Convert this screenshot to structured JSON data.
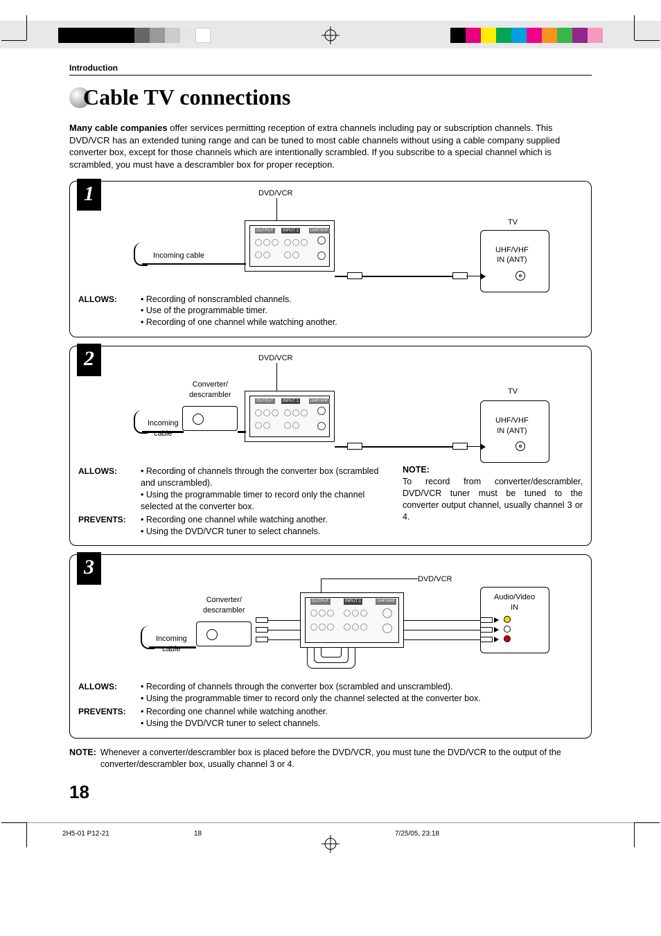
{
  "header": {
    "section_label": "Introduction"
  },
  "title": "Cable TV connections",
  "intro": {
    "bold": "Many cable companies",
    "rest": " offer services permitting reception of extra channels including pay or subscription channels. This DVD/VCR has an extended tuning range and can be tuned to most cable channels without using a cable company supplied converter box, except for those channels which are intentionally scrambled. If you subscribe to a special channel which is scrambled, you must have a descrambler box for proper reception."
  },
  "diagrams": [
    {
      "num": "1",
      "labels": {
        "dvdvcr": "DVD/VCR",
        "tv": "TV",
        "tv_port": "UHF/VHF\nIN (ANT)",
        "incoming": "Incoming cable"
      },
      "allows_label": "ALLOWS:",
      "allows": [
        "Recording of nonscrambled channels.",
        "Use of the programmable timer.",
        "Recording of one channel while watching another."
      ]
    },
    {
      "num": "2",
      "labels": {
        "dvdvcr": "DVD/VCR",
        "tv": "TV",
        "tv_port": "UHF/VHF\nIN (ANT)",
        "incoming": "Incoming\ncable",
        "converter": "Converter/\ndescrambler"
      },
      "allows_label": "ALLOWS:",
      "allows": [
        "Recording of channels through the converter box (scrambled and unscrambled).",
        "Using the programmable timer to record only the channel selected at the converter box."
      ],
      "prevents_label": "PREVENTS:",
      "prevents": [
        "Recording one channel while watching another.",
        "Using the DVD/VCR tuner to select channels."
      ],
      "note_label": "NOTE:",
      "note_text": "To record from converter/descrambler, DVD/VCR tuner must be tuned to the converter output channel, usually channel 3 or 4."
    },
    {
      "num": "3",
      "labels": {
        "dvdvcr": "DVD/VCR",
        "av_in": "Audio/Video\nIN",
        "incoming": "Incoming\ncable",
        "converter": "Converter/\ndescrambler"
      },
      "allows_label": "ALLOWS:",
      "allows": [
        "Recording of channels through the converter box (scrambled and unscrambled).",
        "Using the programmable timer to record only the channel selected at the converter box."
      ],
      "prevents_label": "PREVENTS:",
      "prevents": [
        "Recording one channel while watching another.",
        "Using the DVD/VCR tuner to select channels."
      ]
    }
  ],
  "bottom_note": {
    "label": "NOTE:",
    "text": "Whenever a converter/descrambler box is placed before the DVD/VCR, you must tune the DVD/VCR to the output of the converter/descrambler box, usually channel 3 or 4."
  },
  "page_number": "18",
  "footer": {
    "file": "2H5-01 P12-21",
    "page": "18",
    "date": "7/25/05, 23:18"
  },
  "swatches_bw": [
    "#000",
    "#000",
    "#000",
    "#000",
    "#000",
    "#666",
    "#999",
    "#ccc",
    "#e6e6e6",
    "#fff"
  ],
  "swatches_color": [
    "#000",
    "#e6007e",
    "#ffed00",
    "#00a651",
    "#009fe3",
    "#ec008c",
    "#f7941d",
    "#39b54a",
    "#92278f",
    "#f49ac1"
  ]
}
